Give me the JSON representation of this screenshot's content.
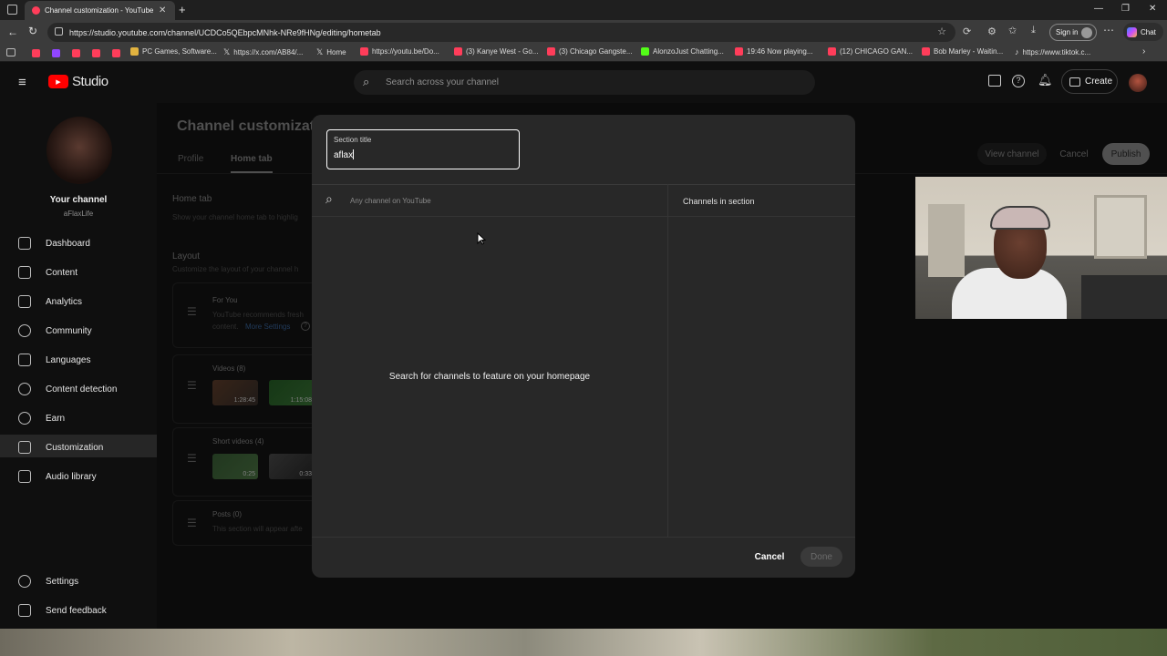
{
  "browser": {
    "tab_title": "Channel customization - YouTube",
    "new_tab_symbol": "+",
    "url": "https://studio.youtube.com/channel/UCDCo5QEbpcMNhk-NRe9fHNg/editing/hometab",
    "sign_in": "Sign in",
    "chat": "Chat",
    "bookmarks": [
      {
        "label": "PC Games, Software...",
        "icon_color": "#e2b340"
      },
      {
        "label": "https://x.com/AB84/...",
        "icon_color": "#ffffff"
      },
      {
        "label": "Home",
        "icon_color": "#ffffff"
      },
      {
        "label": "https://youtu.be/Do...",
        "icon_color": "#ff3d5a"
      },
      {
        "label": "(3) Kanye West - Go...",
        "icon_color": "#ff3d5a"
      },
      {
        "label": "(3) Chicago Gangste...",
        "icon_color": "#ff3d5a"
      },
      {
        "label": "AlonzoJust Chatting...",
        "icon_color": "#53fc18"
      },
      {
        "label": "19:46 Now playing...",
        "icon_color": "#ff3d5a"
      },
      {
        "label": "(12) CHICAGO GAN...",
        "icon_color": "#ff3d5a"
      },
      {
        "label": "Bob Marley - Waitin...",
        "icon_color": "#ff3d5a"
      },
      {
        "label": "https://www.tiktok.c...",
        "icon_color": "#ffffff"
      }
    ]
  },
  "studio": {
    "logo_text": "Studio",
    "search_placeholder": "Search across your channel",
    "create_label": "Create"
  },
  "sidebar": {
    "channel_label": "Your channel",
    "channel_handle": "aFlaxLife",
    "items": [
      {
        "label": "Dashboard",
        "icon": "dashboard-icon"
      },
      {
        "label": "Content",
        "icon": "content-icon"
      },
      {
        "label": "Analytics",
        "icon": "analytics-icon"
      },
      {
        "label": "Community",
        "icon": "community-icon"
      },
      {
        "label": "Languages",
        "icon": "languages-icon"
      },
      {
        "label": "Content detection",
        "icon": "copyright-icon"
      },
      {
        "label": "Earn",
        "icon": "dollar-icon"
      },
      {
        "label": "Customization",
        "icon": "wand-icon"
      },
      {
        "label": "Audio library",
        "icon": "audio-library-icon"
      }
    ],
    "settings": "Settings",
    "feedback": "Send feedback"
  },
  "page": {
    "title": "Channel customizatio",
    "tabs": [
      "Profile",
      "Home tab"
    ],
    "view_channel": "View channel",
    "cancel": "Cancel",
    "publish": "Publish",
    "home_tab_heading": "Home tab",
    "home_tab_desc": "Show your channel home tab to highlig",
    "layout_heading": "Layout",
    "layout_desc": "Customize the layout of your channel h",
    "sections": [
      {
        "title": "For You",
        "desc1": "YouTube recommends fresh",
        "desc2": "content.",
        "link": "More Settings"
      },
      {
        "title": "Videos (8)",
        "durations": [
          "1:28:45",
          "1:15:08"
        ]
      },
      {
        "title": "Short videos (4)",
        "durations": [
          "0:25",
          "0:33"
        ]
      },
      {
        "title": "Posts (0)",
        "desc1": "This section will appear afte"
      }
    ]
  },
  "modal": {
    "title_label": "Section title",
    "title_value": "aflax",
    "search_placeholder": "Any channel on YouTube",
    "right_heading": "Channels in section",
    "empty_message": "Search for channels to feature on your homepage",
    "cancel": "Cancel",
    "done": "Done"
  }
}
